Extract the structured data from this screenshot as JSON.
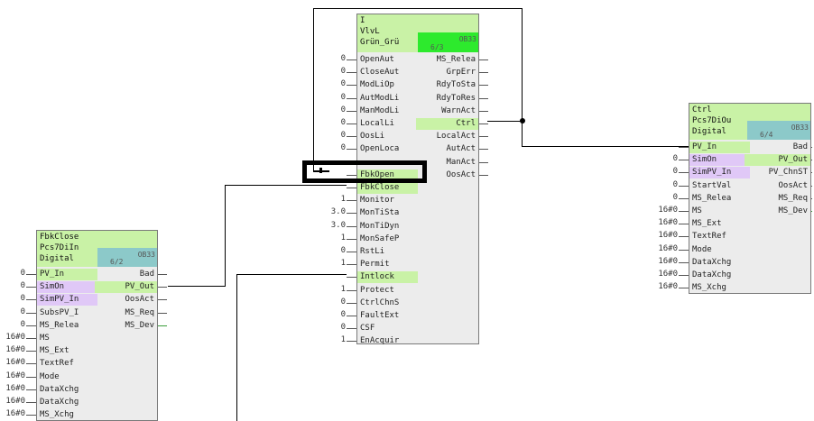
{
  "blocks": {
    "fbkclose": {
      "title": [
        "FbkClose",
        "Pcs7DiIn",
        "Digital"
      ],
      "ob": "OB33",
      "num": "6/2",
      "inputs": [
        {
          "label": "PV_In",
          "value": "0",
          "hl": "green"
        },
        {
          "label": "SimOn",
          "value": "0",
          "hl": "purple"
        },
        {
          "label": "SimPV_In",
          "value": "0",
          "hl": "purple"
        },
        {
          "label": "SubsPV_I",
          "value": "0"
        },
        {
          "label": "MS_Relea",
          "value": "0"
        },
        {
          "label": "MS",
          "value": "16#0"
        },
        {
          "label": "MS_Ext",
          "value": "16#0"
        },
        {
          "label": "TextRef",
          "value": "16#0"
        },
        {
          "label": "Mode",
          "value": "16#0"
        },
        {
          "label": "DataXchg",
          "value": "16#0"
        },
        {
          "label": "DataXchg",
          "value": "16#0"
        },
        {
          "label": "MS_Xchg",
          "value": "16#0"
        }
      ],
      "outputs": [
        {
          "label": "Bad"
        },
        {
          "label": "PV_Out",
          "hl": "green"
        },
        {
          "label": "OosAct"
        },
        {
          "label": "MS_Req"
        },
        {
          "label": "MS_Dev",
          "green": true
        }
      ]
    },
    "vlvl": {
      "title": [
        "I",
        "VlvL",
        "Grün_Grü"
      ],
      "ob": "OB33",
      "num": "6/3",
      "inputs": [
        {
          "label": "OpenAut",
          "value": "0"
        },
        {
          "label": "CloseAut",
          "value": "0"
        },
        {
          "label": "ModLiOp",
          "value": "0"
        },
        {
          "label": "AutModLi",
          "value": "0"
        },
        {
          "label": "ManModLi",
          "value": "0"
        },
        {
          "label": "LocalLi",
          "value": "0"
        },
        {
          "label": "OosLi",
          "value": "0"
        },
        {
          "label": "OpenLoca",
          "value": "0"
        },
        {
          "label": "",
          "value": ""
        },
        {
          "label": "FbkOpen",
          "value": "",
          "hl": "green"
        },
        {
          "label": "FbkClose",
          "value": "",
          "hl": "green"
        },
        {
          "label": "Monitor",
          "value": "1"
        },
        {
          "label": "MonTiSta",
          "value": "3.0"
        },
        {
          "label": "MonTiDyn",
          "value": "3.0"
        },
        {
          "label": "MonSafeP",
          "value": "1"
        },
        {
          "label": "RstLi",
          "value": "0"
        },
        {
          "label": "Permit",
          "value": "1"
        },
        {
          "label": "Intlock",
          "value": "",
          "hl": "green"
        },
        {
          "label": "Protect",
          "value": "1"
        },
        {
          "label": "CtrlChnS",
          "value": "0"
        },
        {
          "label": "FaultExt",
          "value": "0"
        },
        {
          "label": "CSF",
          "value": "0"
        },
        {
          "label": "EnAcquir",
          "value": "1"
        }
      ],
      "outputs": [
        {
          "label": "MS_Relea"
        },
        {
          "label": "GrpErr"
        },
        {
          "label": "RdyToSta"
        },
        {
          "label": "RdyToRes"
        },
        {
          "label": "WarnAct"
        },
        {
          "label": "Ctrl",
          "hl": "green"
        },
        {
          "label": "LocalAct"
        },
        {
          "label": "AutAct"
        },
        {
          "label": "ManAct"
        },
        {
          "label": "OosAct"
        }
      ]
    },
    "ctrl": {
      "title": [
        "Ctrl",
        "Pcs7DiOu",
        "Digital"
      ],
      "ob": "OB33",
      "num": "6/4",
      "inputs": [
        {
          "label": "PV_In",
          "value": "",
          "hl": "green"
        },
        {
          "label": "SimOn",
          "value": "0",
          "hl": "purple"
        },
        {
          "label": "SimPV_In",
          "value": "0",
          "hl": "purple"
        },
        {
          "label": "StartVal",
          "value": "0"
        },
        {
          "label": "MS_Relea",
          "value": "0"
        },
        {
          "label": "MS",
          "value": "16#0"
        },
        {
          "label": "MS_Ext",
          "value": "16#0"
        },
        {
          "label": "TextRef",
          "value": "16#0"
        },
        {
          "label": "Mode",
          "value": "16#0"
        },
        {
          "label": "DataXchg",
          "value": "16#0"
        },
        {
          "label": "DataXchg",
          "value": "16#0"
        },
        {
          "label": "MS_Xchg",
          "value": "16#0"
        }
      ],
      "outputs": [
        {
          "label": "Bad"
        },
        {
          "label": "PV_Out",
          "hl": "green"
        },
        {
          "label": "PV_ChnST"
        },
        {
          "label": "OosAct"
        },
        {
          "label": "MS_Req"
        },
        {
          "label": "MS_Dev",
          "green": true
        }
      ]
    }
  }
}
